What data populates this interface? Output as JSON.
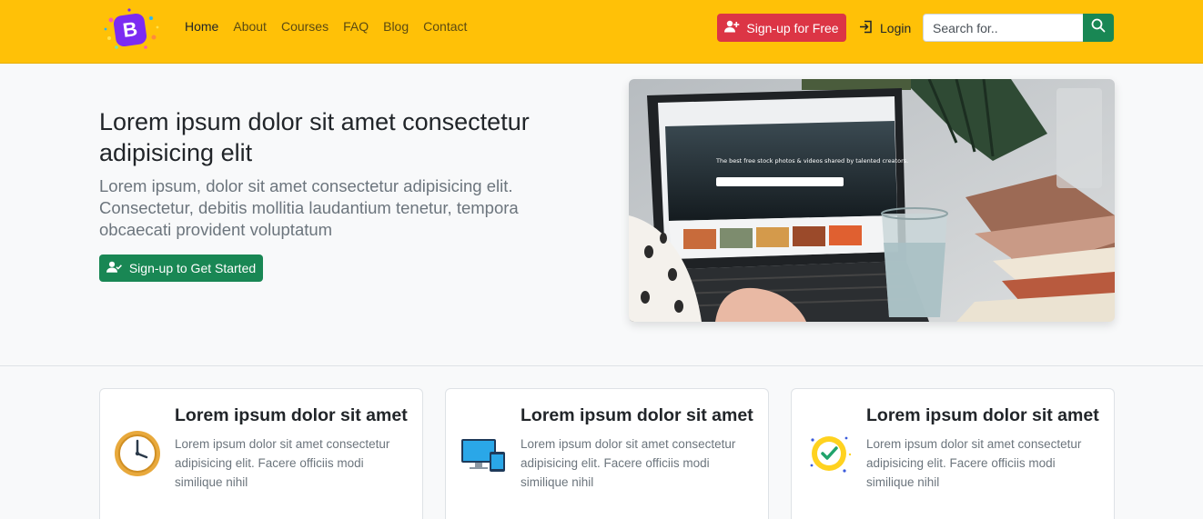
{
  "brand": {
    "logo_letter": "B",
    "logo_icon": "bootstrap-logo-icon"
  },
  "nav": {
    "links": [
      {
        "label": "Home"
      },
      {
        "label": "About"
      },
      {
        "label": "Courses"
      },
      {
        "label": "FAQ"
      },
      {
        "label": "Blog"
      },
      {
        "label": "Contact"
      }
    ],
    "signup_label": "Sign-up for Free",
    "login_label": "Login",
    "search_placeholder": "Search for.."
  },
  "hero": {
    "title": "Lorem ipsum dolor sit amet consectetur adipisicing elit",
    "text": "Lorem ipsum, dolor sit amet consectetur adipisicing elit. Consectetur, debitis mollitia laudantium tenetur, tempora obcaecati provident voluptatum",
    "cta_label": "Sign-up to Get Started",
    "laptop_headline": "The best free stock photos & videos shared by talented creators."
  },
  "features": [
    {
      "icon": "clock-icon",
      "title": "Lorem ipsum dolor sit amet",
      "text": "Lorem ipsum dolor sit amet consectetur adipisicing elit. Facere officiis modi similique nihil"
    },
    {
      "icon": "devices-icon",
      "title": "Lorem ipsum dolor sit amet",
      "text": "Lorem ipsum dolor sit amet consectetur adipisicing elit. Facere officiis modi similique nihil"
    },
    {
      "icon": "check-badge-icon",
      "title": "Lorem ipsum dolor sit amet",
      "text": "Lorem ipsum dolor sit amet consectetur adipisicing elit. Facere officiis modi similique nihil"
    }
  ],
  "colors": {
    "navbar": "#ffc107",
    "danger": "#dc3545",
    "success": "#198754"
  }
}
